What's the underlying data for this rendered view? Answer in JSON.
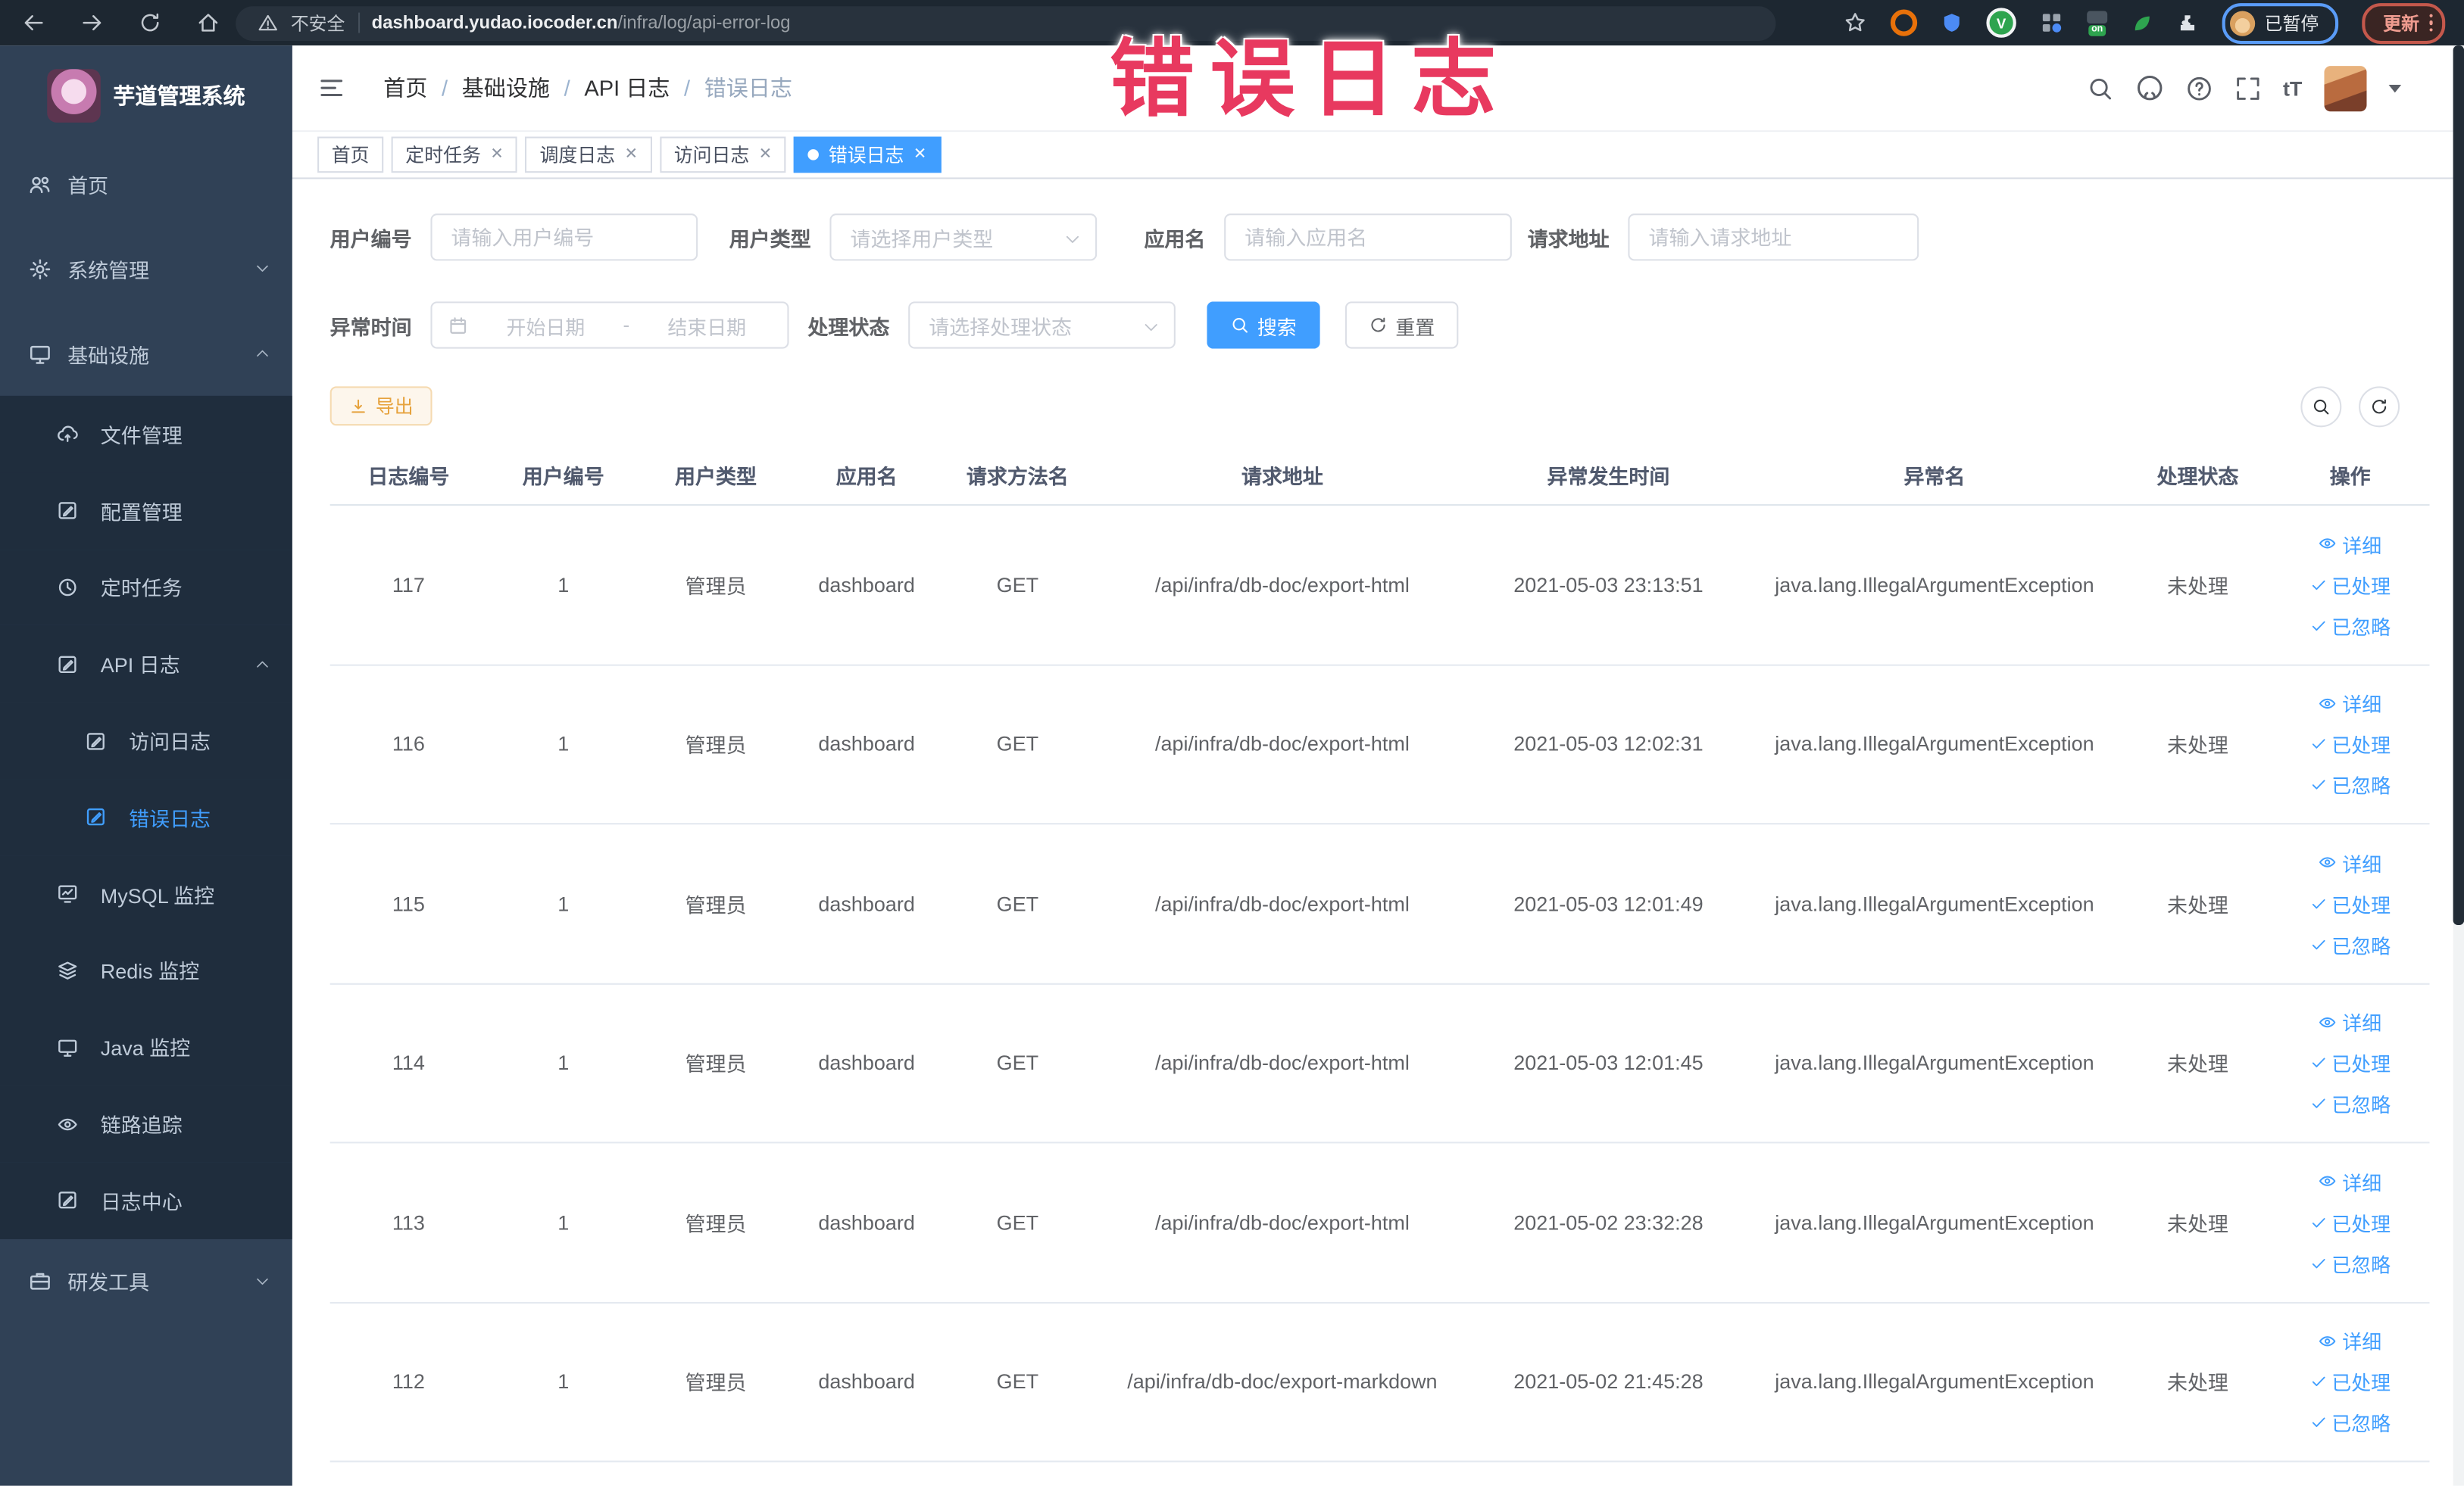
{
  "browser": {
    "security_label": "不安全",
    "url_domain": "dashboard.yudao.iocoder.cn",
    "url_path": "/infra/log/api-error-log",
    "paused_badge": "已暂停",
    "update_badge": "更新"
  },
  "watermark": "错误日志",
  "sidebar": {
    "title": "芋道管理系统",
    "items": [
      {
        "label": "首页",
        "icon": "user-group-icon"
      },
      {
        "label": "系统管理",
        "icon": "gear-icon",
        "chevron": "down"
      },
      {
        "label": "基础设施",
        "icon": "monitor-icon",
        "chevron": "up"
      },
      {
        "label": "文件管理",
        "icon": "cloud-upload-icon"
      },
      {
        "label": "配置管理",
        "icon": "edit-square-icon"
      },
      {
        "label": "定时任务",
        "icon": "clock-icon"
      },
      {
        "label": "API 日志",
        "icon": "log-icon",
        "chevron": "up"
      },
      {
        "label": "访问日志",
        "icon": "log-icon"
      },
      {
        "label": "错误日志",
        "icon": "log-icon",
        "active": true
      },
      {
        "label": "MySQL 监控",
        "icon": "chart-monitor-icon"
      },
      {
        "label": "Redis 监控",
        "icon": "layers-icon"
      },
      {
        "label": "Java 监控",
        "icon": "monitor-icon"
      },
      {
        "label": "链路追踪",
        "icon": "eye-icon"
      },
      {
        "label": "日志中心",
        "icon": "log-icon"
      },
      {
        "label": "研发工具",
        "icon": "briefcase-icon",
        "chevron": "down"
      }
    ]
  },
  "header": {
    "breadcrumb": [
      "首页",
      "基础设施",
      "API 日志",
      "错误日志"
    ],
    "separator": "/",
    "font_size_tool": "tT"
  },
  "tabs": [
    {
      "label": "首页",
      "closable": false,
      "active": false
    },
    {
      "label": "定时任务",
      "closable": true,
      "active": false
    },
    {
      "label": "调度日志",
      "closable": true,
      "active": false
    },
    {
      "label": "访问日志",
      "closable": true,
      "active": false
    },
    {
      "label": "错误日志",
      "closable": true,
      "active": true
    }
  ],
  "filters": {
    "user_id": {
      "label": "用户编号",
      "placeholder": "请输入用户编号"
    },
    "user_type": {
      "label": "用户类型",
      "placeholder": "请选择用户类型"
    },
    "app_name": {
      "label": "应用名",
      "placeholder": "请输入应用名"
    },
    "request_url": {
      "label": "请求地址",
      "placeholder": "请输入请求地址"
    },
    "exception_time": {
      "label": "异常时间",
      "start_placeholder": "开始日期",
      "separator": "-",
      "end_placeholder": "结束日期"
    },
    "process_status": {
      "label": "处理状态",
      "placeholder": "请选择处理状态"
    },
    "search_label": "搜索",
    "reset_label": "重置"
  },
  "toolbar": {
    "export_label": "导出"
  },
  "table": {
    "headers": [
      "日志编号",
      "用户编号",
      "用户类型",
      "应用名",
      "请求方法名",
      "请求地址",
      "异常发生时间",
      "异常名",
      "处理状态",
      "操作"
    ],
    "actions": {
      "detail": "详细",
      "processed": "已处理",
      "ignored": "已忽略"
    },
    "rows": [
      {
        "id": "117",
        "user_id": "1",
        "user_type": "管理员",
        "app": "dashboard",
        "method": "GET",
        "url": "/api/infra/db-doc/export-html",
        "time": "2021-05-03 23:13:51",
        "exception": "java.lang.IllegalArgumentException",
        "status": "未处理"
      },
      {
        "id": "116",
        "user_id": "1",
        "user_type": "管理员",
        "app": "dashboard",
        "method": "GET",
        "url": "/api/infra/db-doc/export-html",
        "time": "2021-05-03 12:02:31",
        "exception": "java.lang.IllegalArgumentException",
        "status": "未处理"
      },
      {
        "id": "115",
        "user_id": "1",
        "user_type": "管理员",
        "app": "dashboard",
        "method": "GET",
        "url": "/api/infra/db-doc/export-html",
        "time": "2021-05-03 12:01:49",
        "exception": "java.lang.IllegalArgumentException",
        "status": "未处理"
      },
      {
        "id": "114",
        "user_id": "1",
        "user_type": "管理员",
        "app": "dashboard",
        "method": "GET",
        "url": "/api/infra/db-doc/export-html",
        "time": "2021-05-03 12:01:45",
        "exception": "java.lang.IllegalArgumentException",
        "status": "未处理"
      },
      {
        "id": "113",
        "user_id": "1",
        "user_type": "管理员",
        "app": "dashboard",
        "method": "GET",
        "url": "/api/infra/db-doc/export-html",
        "time": "2021-05-02 23:32:28",
        "exception": "java.lang.IllegalArgumentException",
        "status": "未处理"
      },
      {
        "id": "112",
        "user_id": "1",
        "user_type": "管理员",
        "app": "dashboard",
        "method": "GET",
        "url": "/api/infra/db-doc/export-markdown",
        "time": "2021-05-02 21:45:28",
        "exception": "java.lang.IllegalArgumentException",
        "status": "未处理"
      }
    ]
  },
  "colors": {
    "accent": "#409eff",
    "sidebar_bg": "#304156",
    "submenu_bg": "#1f2d3d",
    "watermark": "#e8395f",
    "export": "#e6a23c"
  }
}
